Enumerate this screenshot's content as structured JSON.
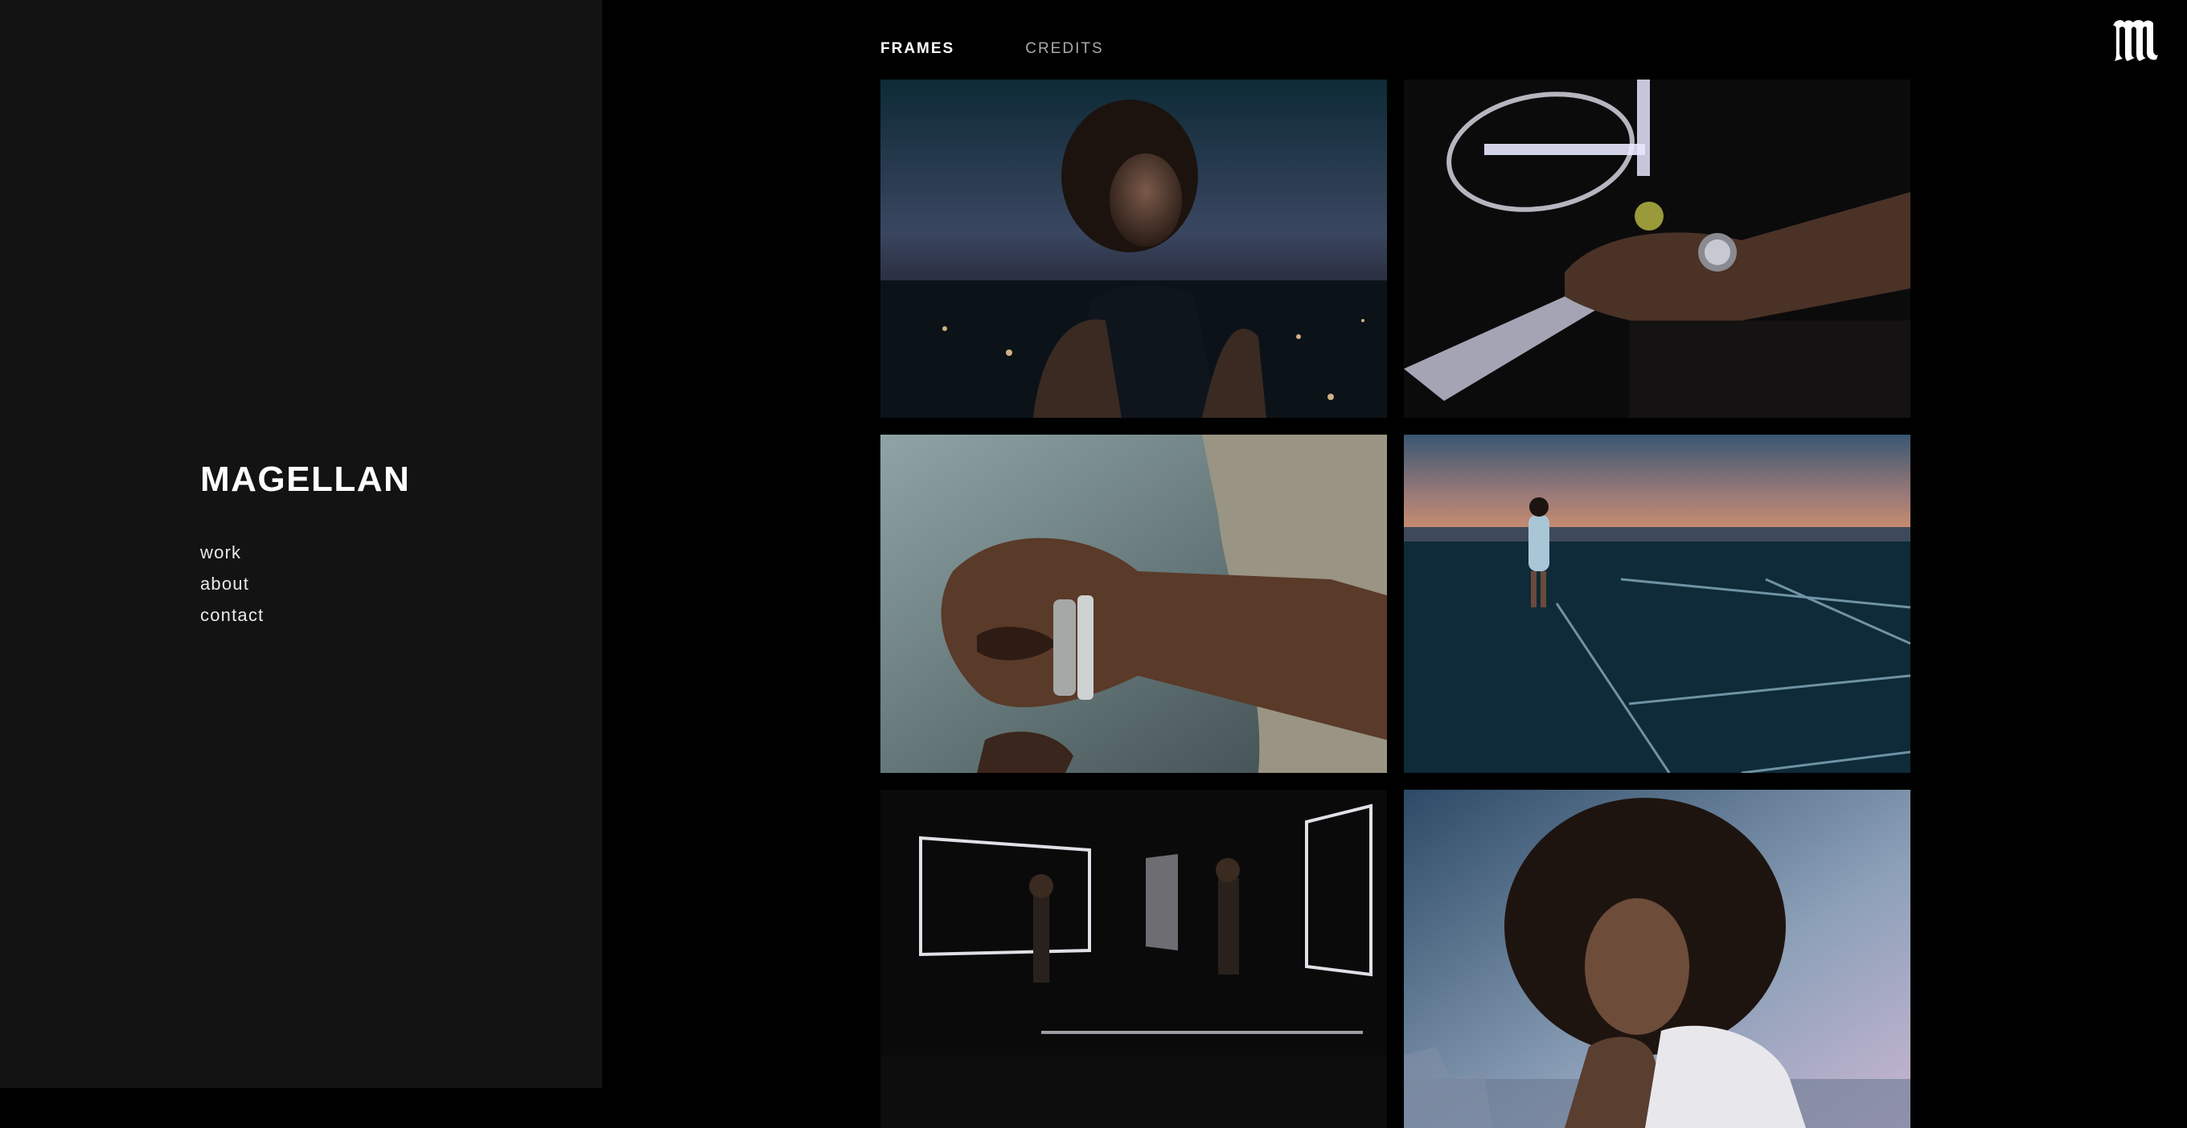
{
  "sidebar": {
    "brand": "MAGELLAN",
    "nav": [
      {
        "label": "work"
      },
      {
        "label": "about"
      },
      {
        "label": "contact"
      }
    ]
  },
  "header": {
    "tabs": [
      {
        "label": "FRAMES",
        "active": true
      },
      {
        "label": "CREDITS",
        "active": false
      }
    ],
    "logo_icon": "blackletter-m-icon"
  },
  "frames": [
    {
      "icon": "frame-portrait-city-dusk"
    },
    {
      "icon": "frame-watch-racket-neon"
    },
    {
      "icon": "frame-wrist-watch-closeup"
    },
    {
      "icon": "frame-tennis-court-sunset"
    },
    {
      "icon": "frame-mirror-room-neon"
    },
    {
      "icon": "frame-portrait-curly-hair"
    }
  ],
  "colors": {
    "sidebar_bg": "#131313",
    "main_bg": "#000000",
    "text_primary": "#ffffff",
    "text_muted": "#a9a9a9"
  }
}
